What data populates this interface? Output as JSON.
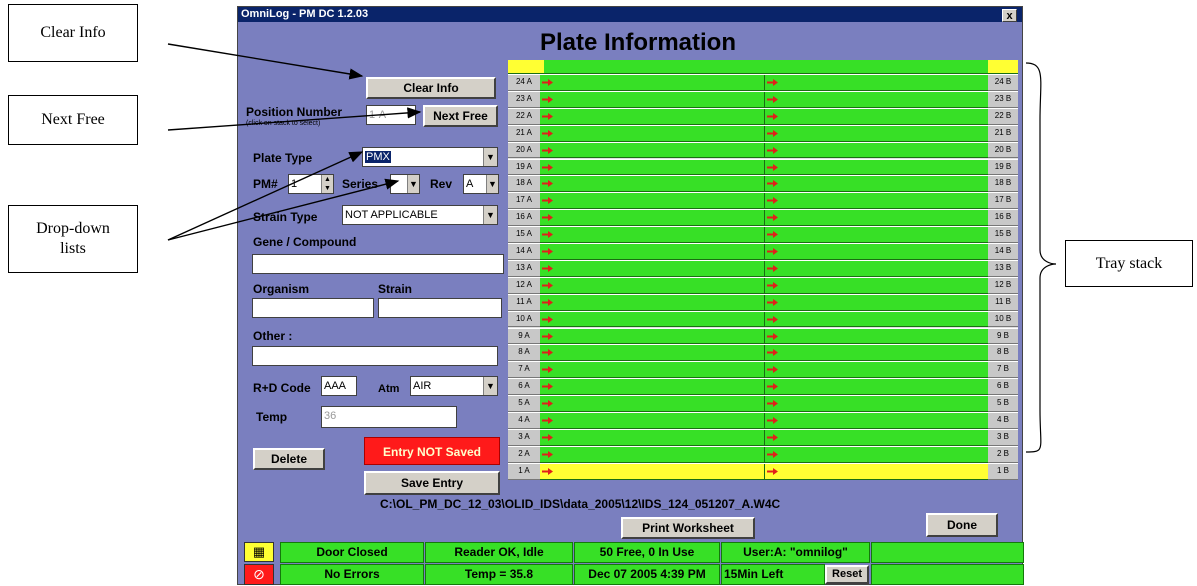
{
  "callouts": {
    "clear_info": "Clear Info",
    "next_free": "Next Free",
    "dropdown": "Drop-down lists",
    "tray_stack": "Tray stack"
  },
  "window": {
    "title": "OmniLog - PM DC 1.2.03",
    "close": "x",
    "heading": "Plate Information"
  },
  "form": {
    "clear_info_btn": "Clear Info",
    "position_label": "Position Number",
    "position_hint": "(click on stack to select)",
    "position_value": "1-A",
    "next_free_btn": "Next Free",
    "plate_type_label": "Plate Type",
    "plate_type_value": "PMX",
    "pm_label": "PM#",
    "pm_value": "1",
    "series_label": "Series",
    "series_value": "",
    "rev_label": "Rev",
    "rev_value": "A",
    "strain_type_label": "Strain Type",
    "strain_type_value": "NOT APPLICABLE",
    "gene_label": "Gene / Compound",
    "gene_value": "",
    "organism_label": "Organism",
    "organism_value": "",
    "strain_label": "Strain",
    "strain_value": "",
    "other_label": "Other :",
    "other_value": "",
    "rd_label": "R+D Code",
    "rd_value": "AAA",
    "atm_label": "Atm",
    "atm_value": "AIR",
    "temp_label": "Temp",
    "temp_value": "36",
    "delete_btn": "Delete",
    "not_saved": "Entry NOT Saved",
    "save_btn": "Save Entry",
    "file_path": "C:\\OL_PM_DC_12_03\\OLID_IDS\\data_2005\\12\\IDS_124_051207_A.W4C",
    "print_btn": "Print Worksheet",
    "done_btn": "Done"
  },
  "tray": {
    "left_labels": [
      "24 A",
      "23 A",
      "22 A",
      "21 A",
      "20 A",
      "19 A",
      "18 A",
      "17 A",
      "16 A",
      "15 A",
      "14 A",
      "13 A",
      "12 A",
      "11 A",
      "10 A",
      "9 A",
      "8 A",
      "7 A",
      "6 A",
      "5 A",
      "4 A",
      "3 A",
      "2 A",
      "1 A"
    ],
    "right_labels": [
      "24 B",
      "23 B",
      "22 B",
      "21 B",
      "20 B",
      "19 B",
      "18 B",
      "17 B",
      "16 B",
      "15 B",
      "14 B",
      "13 B",
      "12 B",
      "11 B",
      "10 B",
      "9 B",
      "8 B",
      "7 B",
      "6 B",
      "5 B",
      "4 B",
      "3 B",
      "2 B",
      "1 B"
    ],
    "selected_row": "1 A",
    "row_color": "#37e026",
    "selected_color": "#ffff33"
  },
  "status": {
    "row1": [
      "Door Closed",
      "Reader OK, Idle",
      "50 Free, 0 In Use",
      "User:A: \"omnilog\"",
      ""
    ],
    "row2": [
      "No Errors",
      "Temp = 35.8",
      "Dec 07 2005 4:39 PM"
    ],
    "time_left": "15Min Left",
    "reset_btn": "Reset",
    "row1_icon": "tray-icon",
    "row2_icon": "no-error-icon"
  }
}
